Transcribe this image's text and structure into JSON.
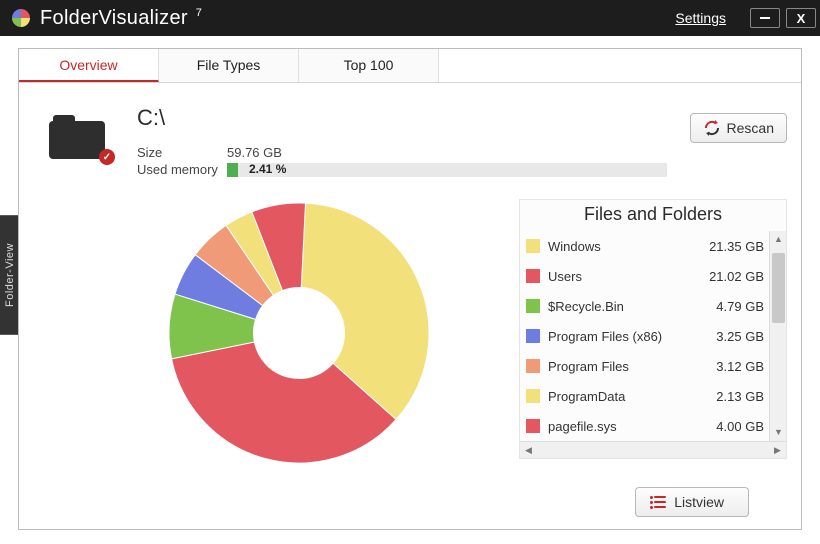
{
  "app": {
    "title": "FolderVisualizer",
    "version": "7"
  },
  "titlebar": {
    "settings": "Settings"
  },
  "tabs": [
    {
      "label": "Overview",
      "active": true
    },
    {
      "label": "File Types",
      "active": false
    },
    {
      "label": "Top 100",
      "active": false
    }
  ],
  "drive": {
    "path": "C:\\",
    "size_label": "Size",
    "size_value": "59.76 GB",
    "used_label": "Used memory",
    "used_percent_text": "2.41 %",
    "used_percent": 2.41
  },
  "buttons": {
    "rescan": "Rescan",
    "listview": "Listview"
  },
  "side_tab": "Folder-View",
  "files_title": "Files and Folders",
  "items": [
    {
      "name": "Windows",
      "size": "21.35 GB",
      "color": "#f2e07a"
    },
    {
      "name": "Users",
      "size": "21.02 GB",
      "color": "#e25760"
    },
    {
      "name": "$Recycle.Bin",
      "size": "4.79 GB",
      "color": "#7fc24c"
    },
    {
      "name": "Program Files (x86)",
      "size": "3.25 GB",
      "color": "#6f7de0"
    },
    {
      "name": "Program Files",
      "size": "3.12 GB",
      "color": "#f09a77"
    },
    {
      "name": "ProgramData",
      "size": "2.13 GB",
      "color": "#f2e07a"
    },
    {
      "name": "pagefile.sys",
      "size": "4.00 GB",
      "color": "#e25760"
    }
  ],
  "chart_data": {
    "type": "pie",
    "title": "",
    "categories": [
      "Windows",
      "Users",
      "$Recycle.Bin",
      "Program Files (x86)",
      "Program Files",
      "ProgramData",
      "pagefile.sys"
    ],
    "values": [
      21.35,
      21.02,
      4.79,
      3.25,
      3.12,
      2.13,
      4.0
    ],
    "colors": [
      "#f2e07a",
      "#e25760",
      "#7fc24c",
      "#6f7de0",
      "#f09a77",
      "#f2e07a",
      "#e25760"
    ],
    "hole": 0.35,
    "unit": "GB"
  }
}
